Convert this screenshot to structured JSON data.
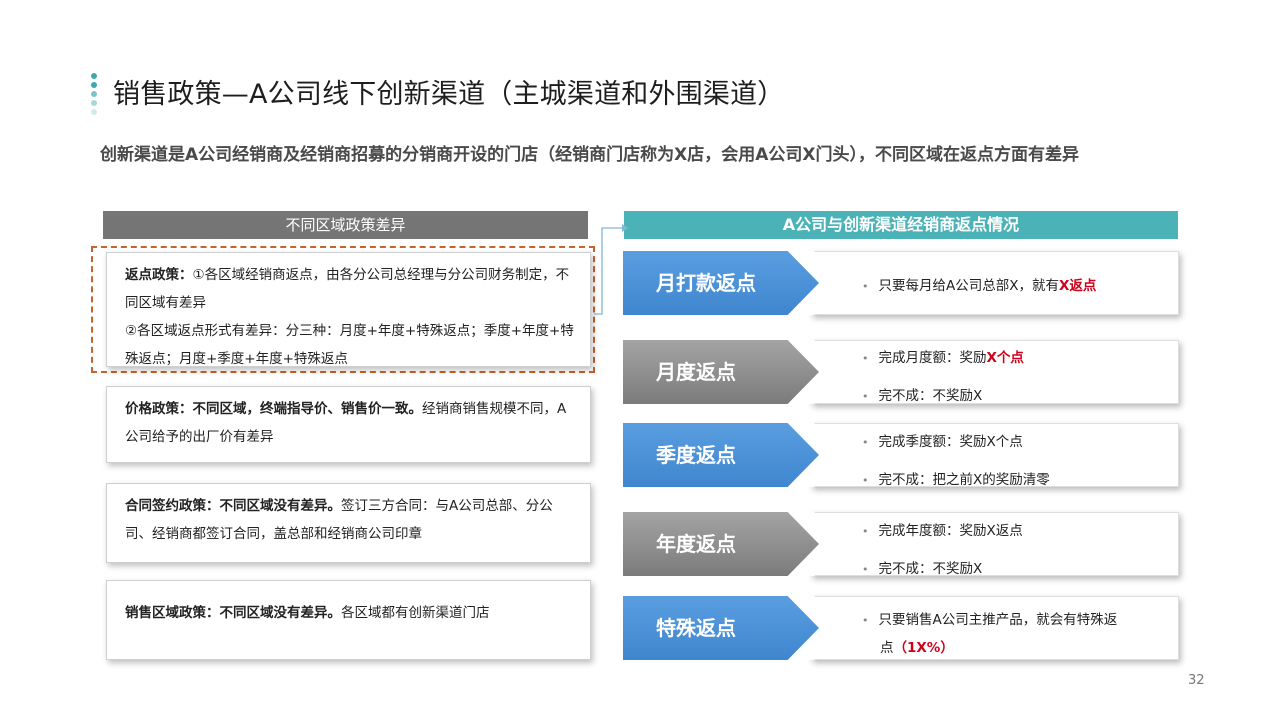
{
  "title": "销售政策—A公司线下创新渠道（主城渠道和外围渠道）",
  "subtitle": "创新渠道是A公司经销商及经销商招募的分销商开设的门店（经销商门店称为X店，会用A公司X门头），不同区域在返点方面有差异",
  "left_header": "不同区域政策差异",
  "right_header": "A公司与创新渠道经销商返点情况",
  "cards": [
    {
      "line1_bold": "返点政策：",
      "line1_text": "①各区域经销商返点，由各分公司总经理与分公司财务制定，不同区域有差异",
      "line2_text": "②各区域返点形式有差异：分三种：月度+年度+特殊返点；季度+年度+特殊返点；月度+季度+年度+特殊返点"
    },
    {
      "bold": "价格政策：不同区域，终端指导价、销售价一致。",
      "text": "经销商销售规模不同，A公司给予的出厂价有差异"
    },
    {
      "bold": "合同签约政策：不同区域没有差异。",
      "text": "签订三方合同：与A公司总部、分公司、经销商都签订合同，盖总部和经销商公司印章"
    },
    {
      "bold": "销售区域政策：不同区域没有差异。",
      "text": "各区域都有创新渠道门店"
    }
  ],
  "rows": [
    {
      "label": "月打款返点",
      "b1": "只要每月给A公司总部X，就有",
      "b1_red": "X返点"
    },
    {
      "label": "月度返点",
      "b1": "完成月度额：奖励",
      "b1_red": "X个点",
      "b2": "完不成：不奖励X"
    },
    {
      "label": "季度返点",
      "b1": "完成季度额：奖励X个点",
      "b2": "完不成：把之前X的奖励清零"
    },
    {
      "label": "年度返点",
      "b1": "完成年度额：奖励X返点",
      "b2": "完不成：不奖励X"
    },
    {
      "label": "特殊返点",
      "b1": "只要销售A公司主推产品，就会有特殊返",
      "b2_prefix": "点",
      "b2_red": "（1X%）"
    }
  ],
  "bullet_glyph": "•",
  "page_number": "32",
  "colors": {
    "teal": "#4bb3b7",
    "blue": "#4a90d9",
    "grey": "#8a8a8a",
    "red": "#d0021b",
    "dash": "#c9622b"
  }
}
